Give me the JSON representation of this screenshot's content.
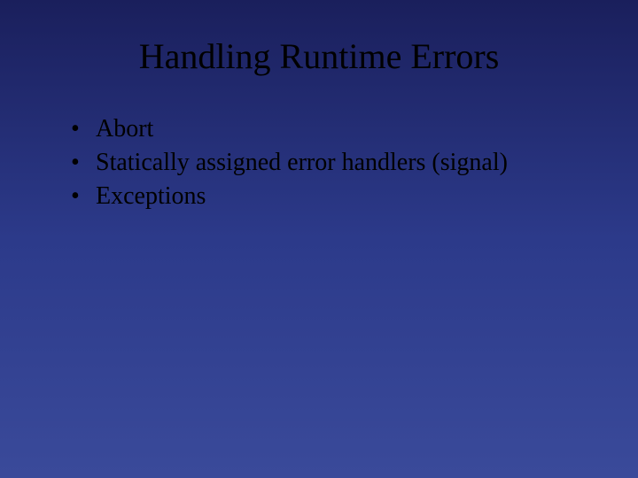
{
  "slide": {
    "title": "Handling Runtime Errors",
    "bullets": [
      "Abort",
      "Statically assigned error handlers (signal)",
      "Exceptions"
    ]
  }
}
